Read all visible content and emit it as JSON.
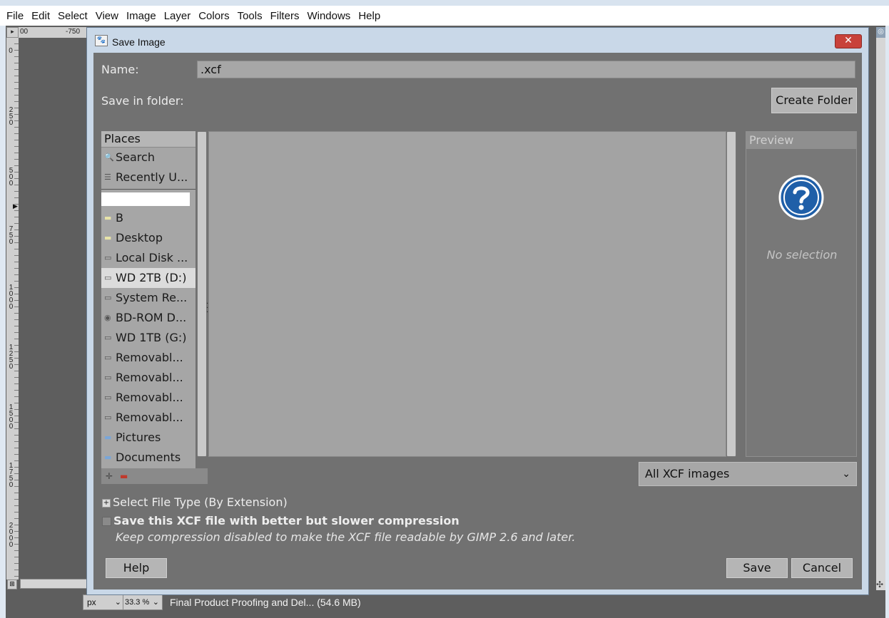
{
  "menubar": {
    "items": [
      "File",
      "Edit",
      "Select",
      "View",
      "Image",
      "Layer",
      "Colors",
      "Tools",
      "Filters",
      "Windows",
      "Help"
    ]
  },
  "rulers": {
    "h_labels": [
      "00",
      "-750"
    ],
    "v_labels": [
      "0",
      "250",
      "500",
      "750",
      "1000",
      "1250",
      "1500",
      "1750",
      "2000"
    ]
  },
  "dialog": {
    "title": "Save Image",
    "name_label": "Name:",
    "name_value": ".xcf",
    "folder_label": "Save in folder:",
    "create_folder": "Create Folder",
    "places": {
      "header": "Places",
      "top_items": [
        {
          "label": "Search",
          "icon": "search-icon"
        },
        {
          "label": "Recently U...",
          "icon": "recent-icon"
        }
      ],
      "items": [
        {
          "label": "B",
          "icon": "folder-icon"
        },
        {
          "label": "Desktop",
          "icon": "folder-icon"
        },
        {
          "label": "Local Disk ...",
          "icon": "drive-icon"
        },
        {
          "label": "WD 2TB (D:)",
          "icon": "drive-icon",
          "selected": true
        },
        {
          "label": "System Re...",
          "icon": "drive-icon"
        },
        {
          "label": "BD-ROM D...",
          "icon": "optical-drive-icon"
        },
        {
          "label": "WD 1TB (G:)",
          "icon": "drive-icon"
        },
        {
          "label": "Removabl...",
          "icon": "removable-drive-icon"
        },
        {
          "label": "Removabl...",
          "icon": "removable-drive-icon"
        },
        {
          "label": "Removabl...",
          "icon": "removable-drive-icon"
        },
        {
          "label": "Removabl...",
          "icon": "removable-drive-icon"
        },
        {
          "label": "Pictures",
          "icon": "blue-folder-icon"
        },
        {
          "label": "Documents",
          "icon": "blue-folder-icon"
        }
      ]
    },
    "preview": {
      "header": "Preview",
      "empty_text": "No selection"
    },
    "file_filter": "All XCF images",
    "file_type_expander": "Select File Type (By Extension)",
    "compression_checkbox": "Save this XCF file with better but slower compression",
    "compression_hint": "Keep compression disabled to make the XCF file readable by GIMP 2.6 and later.",
    "help_button": "Help",
    "save_button": "Save",
    "cancel_button": "Cancel"
  },
  "statusbar": {
    "unit": "px",
    "zoom": "33.3 %",
    "text": "Final Product Proofing and Del... (54.6 MB)"
  },
  "colors": {
    "dialog_bg": "#717171",
    "close_button": "#c8413a",
    "help_icon_blue": "#1f5fa8"
  }
}
